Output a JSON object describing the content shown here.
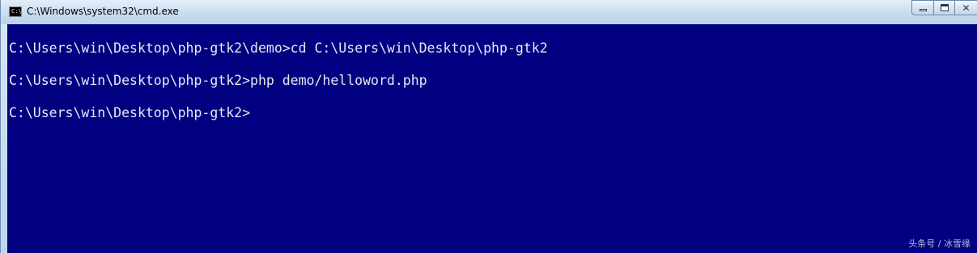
{
  "window": {
    "title": "C:\\Windows\\system32\\cmd.exe",
    "app_icon": "cmd-icon",
    "app_icon_text": "C:\\"
  },
  "controls": {
    "minimize_icon": "minimize-icon",
    "maximize_icon": "maximize-icon",
    "close_icon": "close-icon",
    "close_glyph": "✕"
  },
  "console": {
    "background": "#000080",
    "foreground": "#e8e8f4",
    "lines": [
      "C:\\Users\\win\\Desktop\\php-gtk2\\demo>cd C:\\Users\\win\\Desktop\\php-gtk2",
      "C:\\Users\\win\\Desktop\\php-gtk2>php demo/helloword.php",
      "C:\\Users\\win\\Desktop\\php-gtk2>"
    ]
  },
  "watermark": "头条号 / 冰雪缘"
}
